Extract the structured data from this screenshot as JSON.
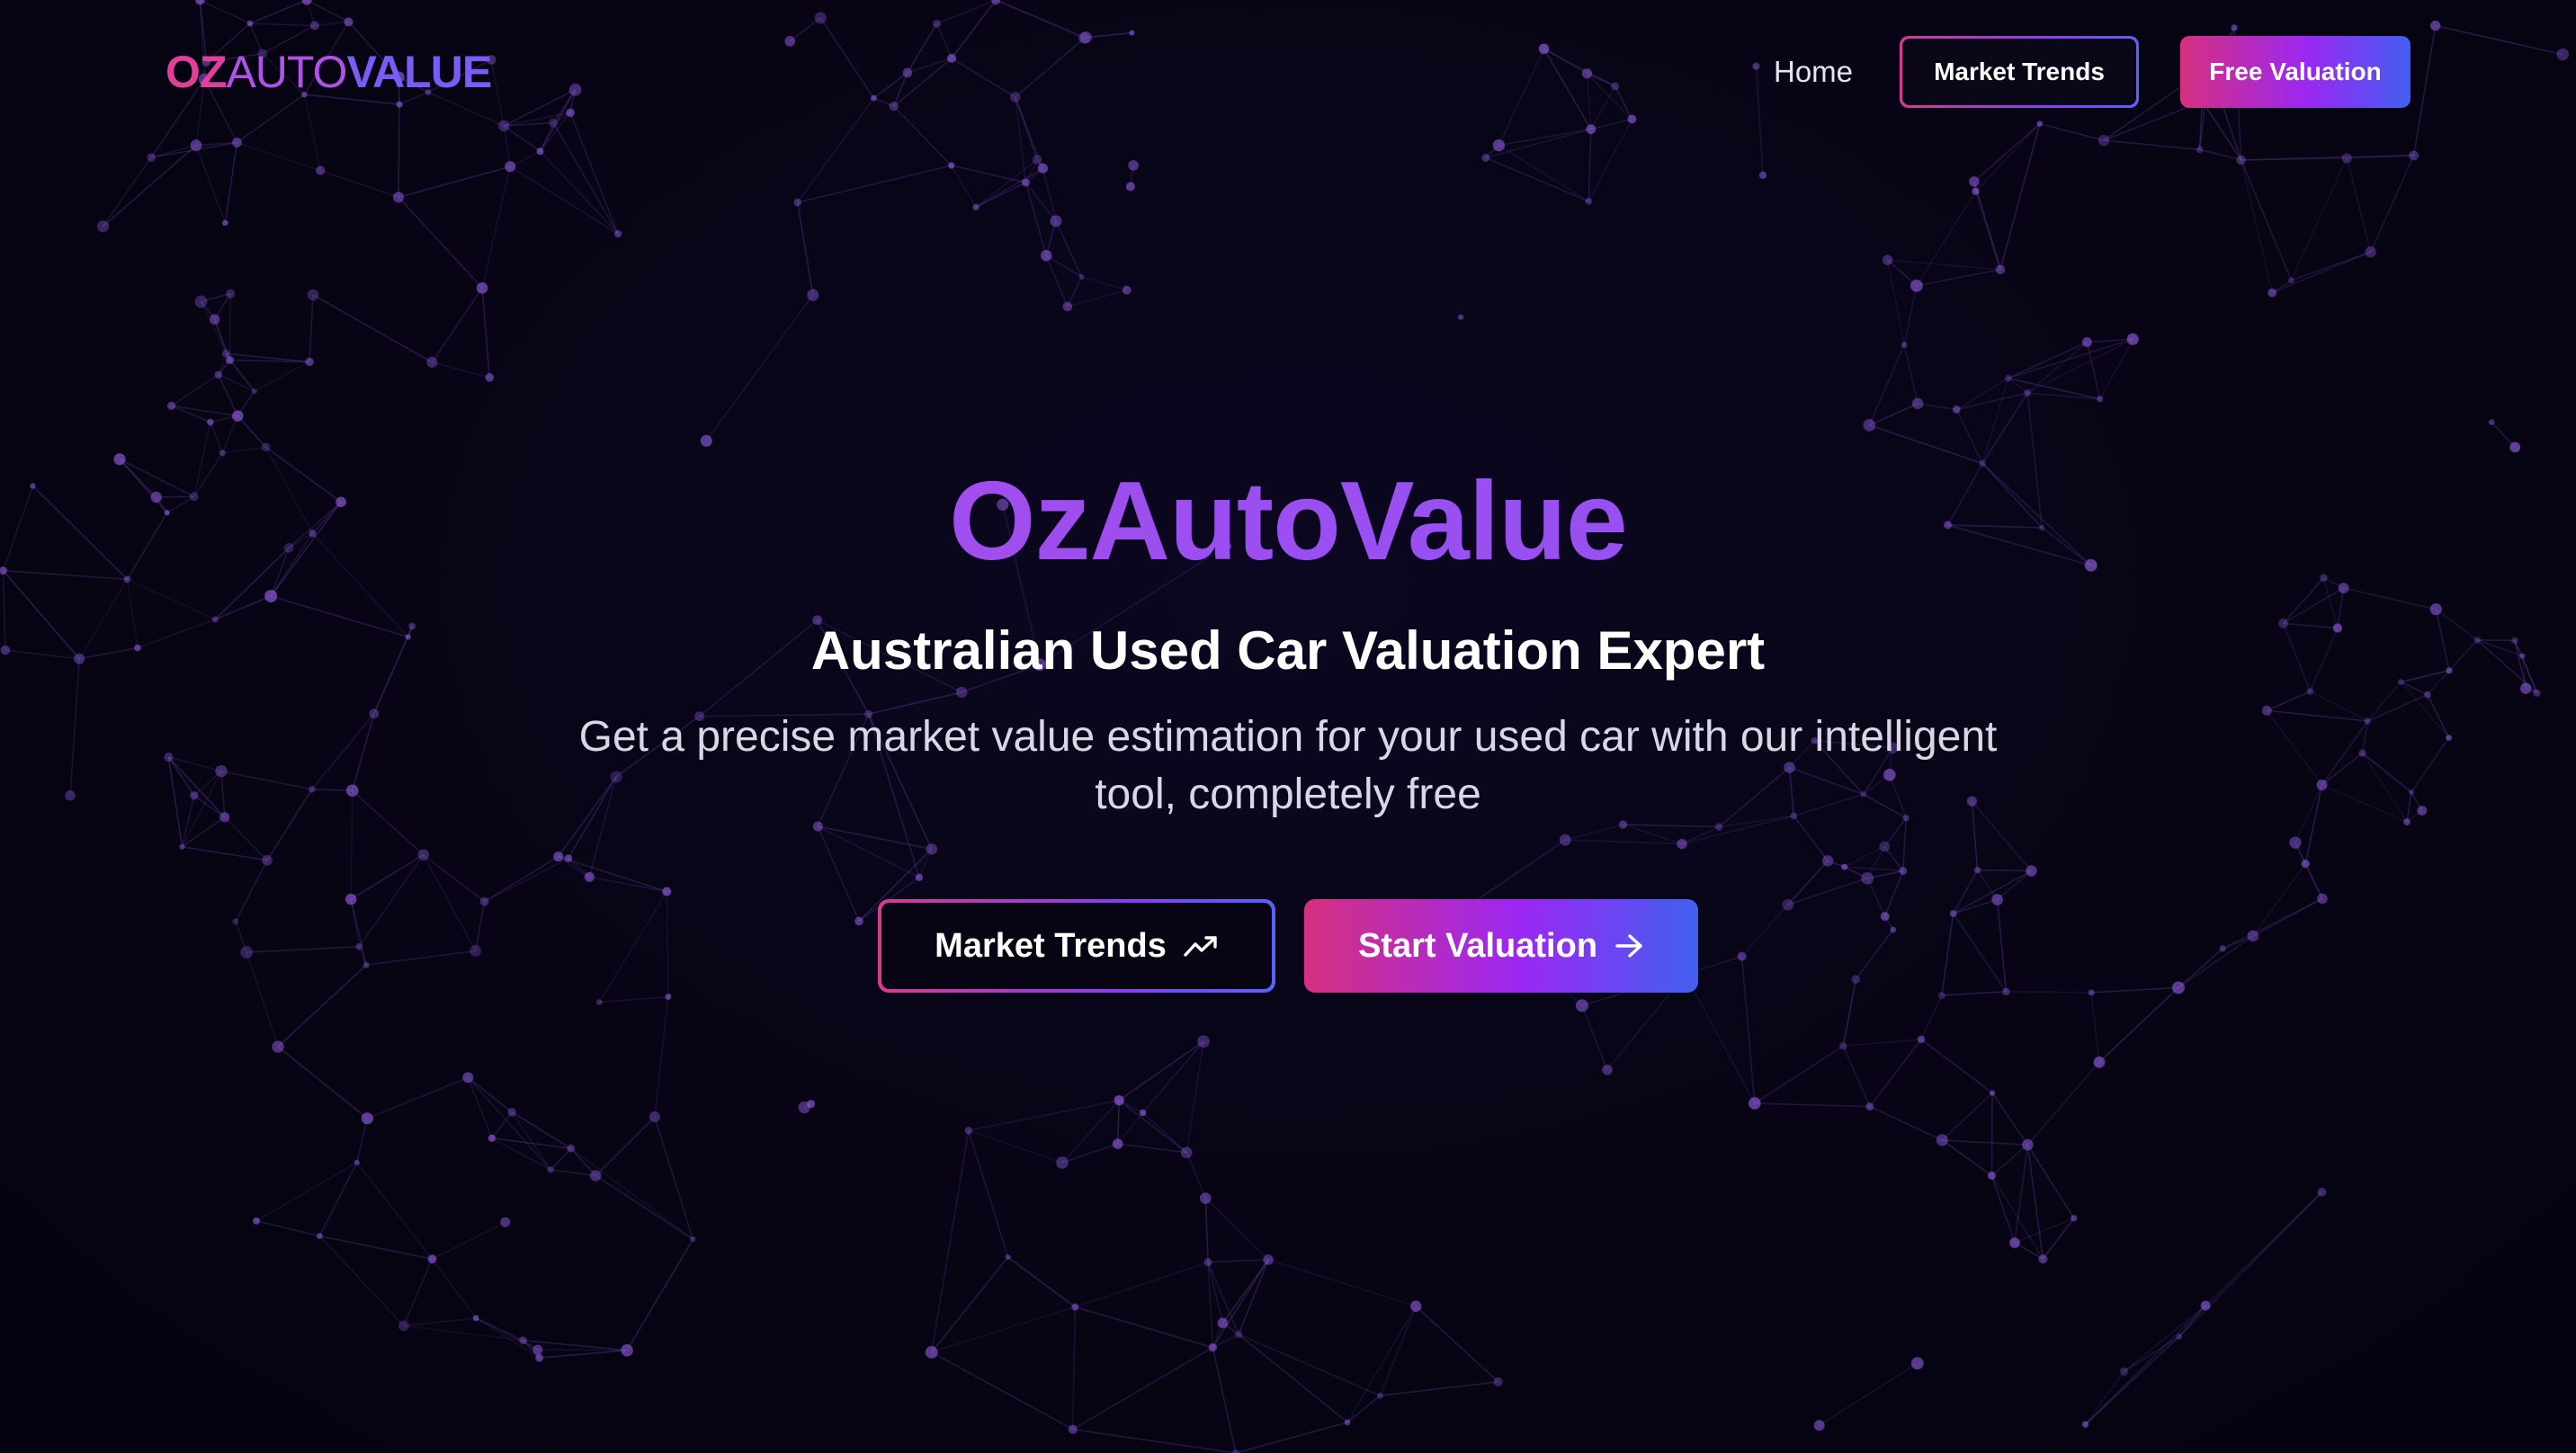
{
  "header": {
    "logo": {
      "part1": "OZ",
      "part2": "AUTO",
      "part3": "VALUE"
    },
    "nav": {
      "home_label": "Home",
      "market_trends_label": "Market Trends",
      "free_valuation_label": "Free Valuation"
    }
  },
  "hero": {
    "title": "OzAutoValue",
    "subtitle": "Australian Used Car Valuation Expert",
    "description": "Get a precise market value estimation for your used car with our intelligent tool, completely free",
    "buttons": {
      "market_trends_label": "Market Trends",
      "start_valuation_label": "Start Valuation"
    },
    "icons": {
      "market_trends": "trending-up-icon",
      "start_valuation": "arrow-right-icon"
    }
  },
  "theme": {
    "background": "#070414",
    "accent_pink": "#d6307f",
    "accent_purple": "#9b27f2",
    "accent_blue": "#4160f0",
    "title_purple": "#a04ef0"
  }
}
